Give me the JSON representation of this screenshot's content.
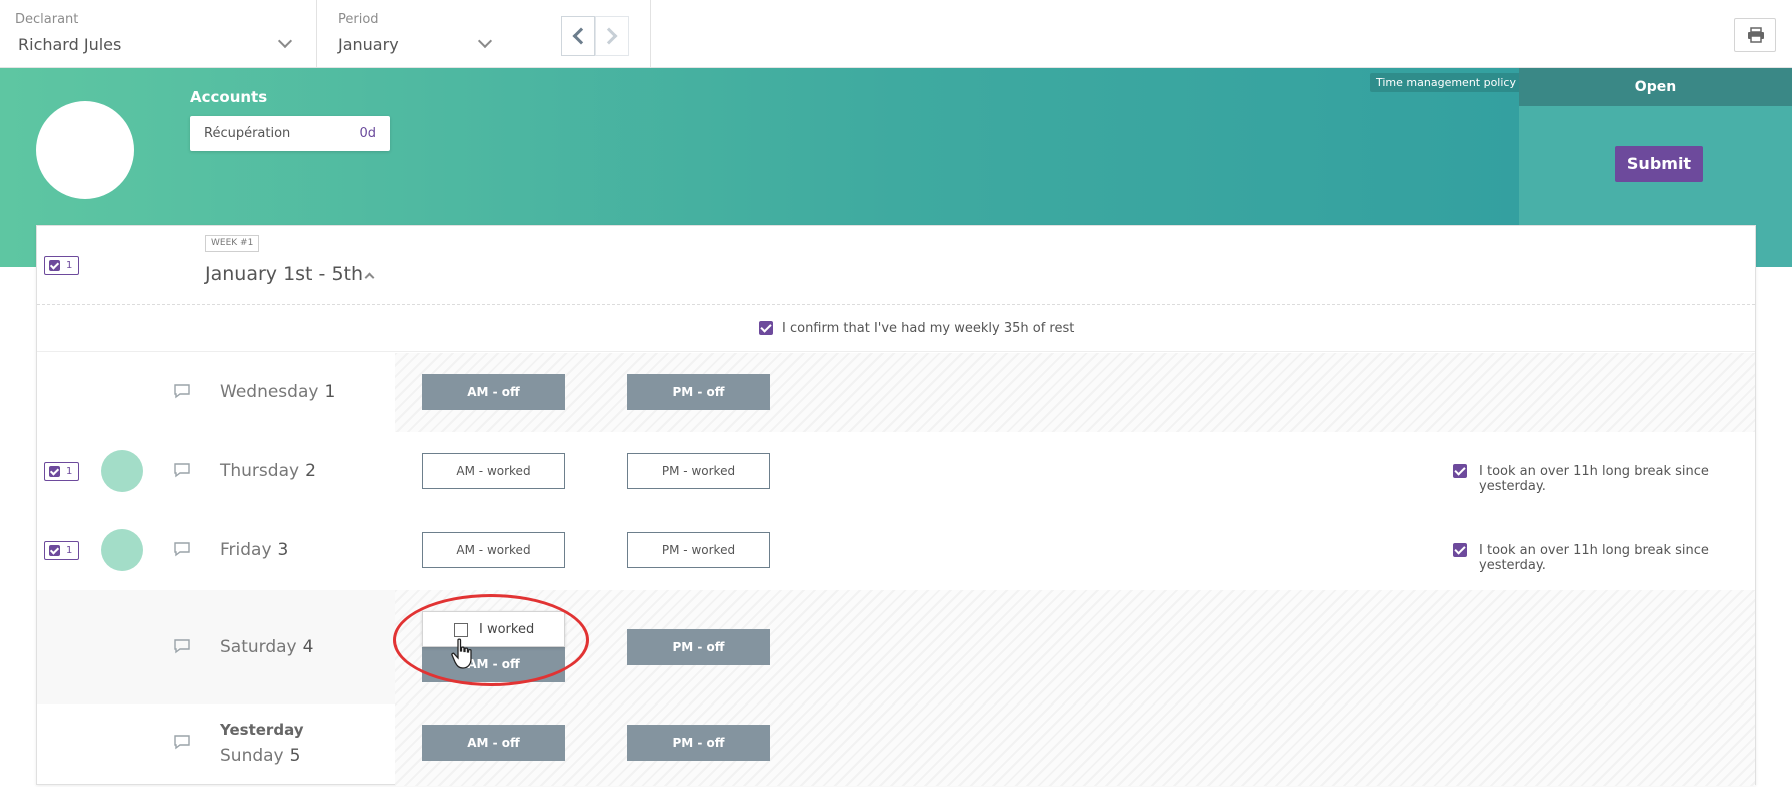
{
  "topbar": {
    "declarant_label": "Declarant",
    "declarant_value": "Richard Jules",
    "period_label": "Period",
    "period_value": "January"
  },
  "accounts": {
    "title": "Accounts",
    "items": [
      {
        "name": "Récupération",
        "value": "0d"
      }
    ]
  },
  "policy_badge": "Time management policy",
  "status": {
    "label": "Open",
    "submit_label": "Submit"
  },
  "week": {
    "tag": "WEEK #1",
    "title": "January 1st - 5th",
    "badge_count": "1",
    "rest_confirmation": "I confirm that I've had my weekly 35h of rest"
  },
  "days": [
    {
      "name": "Wednesday",
      "num": "1",
      "am": "AM - off",
      "pm": "PM - off"
    },
    {
      "name": "Thursday",
      "num": "2",
      "am": "AM - worked",
      "pm": "PM - worked",
      "badge": "1",
      "break_text": "I took an over 11h long break since yesterday."
    },
    {
      "name": "Friday",
      "num": "3",
      "am": "AM - worked",
      "pm": "PM - worked",
      "badge": "1",
      "break_text": "I took an over 11h long break since yesterday."
    },
    {
      "name": "Saturday",
      "num": "4",
      "am": "AM - off",
      "pm": "PM - off",
      "popup": "I worked"
    },
    {
      "label": "Yesterday",
      "name": "Sunday",
      "num": "5",
      "am": "AM - off",
      "pm": "PM - off"
    }
  ],
  "icons": {
    "print": "printer-icon",
    "comment": "speech-bubble-icon",
    "prev": "chevron-left-icon",
    "next": "chevron-right-icon"
  },
  "colors": {
    "accent": "#6d4a9c",
    "off_slot": "#84949f",
    "banner_start": "#5ec6a2",
    "banner_end": "#2f9ca0",
    "highlight": "#e13333"
  }
}
